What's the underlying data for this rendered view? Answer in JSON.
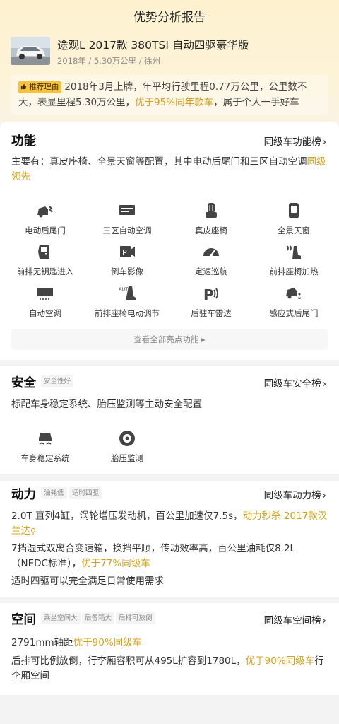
{
  "header": {
    "title": "优势分析报告"
  },
  "car": {
    "name": "途观L 2017款 380TSI 自动四驱豪华版",
    "meta": "2018年 / 5.30万公里 / 徐州"
  },
  "reason": {
    "tag": "推荐理由",
    "text1": "2018年3月上牌，年平均行驶里程0.77万公里，公里数不大，表显里程5.30万公里，",
    "highlight": "优于95%同年款车",
    "text2": "，属于个人一手好车"
  },
  "function": {
    "title": "功能",
    "rank_link": "同级车功能榜",
    "summary1": "主要有：真皮座椅、全景天窗等配置，其中电动后尾门和三区自动空调",
    "summary_hl": "同级领先",
    "features": [
      {
        "label": "电动后尾门",
        "icon": "power-tailgate-icon"
      },
      {
        "label": "三区自动空调",
        "icon": "tri-zone-ac-icon"
      },
      {
        "label": "真皮座椅",
        "icon": "leather-seat-icon"
      },
      {
        "label": "全景天窗",
        "icon": "panoramic-sunroof-icon"
      },
      {
        "label": "前排无钥匙进入",
        "icon": "keyless-entry-icon"
      },
      {
        "label": "倒车影像",
        "icon": "reverse-camera-icon"
      },
      {
        "label": "定速巡航",
        "icon": "cruise-control-icon"
      },
      {
        "label": "前排座椅加热",
        "icon": "seat-heating-icon"
      },
      {
        "label": "自动空调",
        "icon": "auto-ac-icon"
      },
      {
        "label": "前排座椅电动调节",
        "icon": "power-seat-icon"
      },
      {
        "label": "后驻车雷达",
        "icon": "parking-radar-icon"
      },
      {
        "label": "感应式后尾门",
        "icon": "sensor-tailgate-icon"
      }
    ],
    "view_all": "查看全部亮点功能 ▸"
  },
  "safety": {
    "title": "安全",
    "tag": "安全性好",
    "rank_link": "同级车安全榜",
    "summary": "标配车身稳定系统、胎压监测等主动安全配置",
    "features": [
      {
        "label": "车身稳定系统",
        "icon": "stability-control-icon"
      },
      {
        "label": "胎压监测",
        "icon": "tire-pressure-icon"
      }
    ]
  },
  "power": {
    "title": "动力",
    "tags": [
      "油耗低",
      "适时四驱"
    ],
    "rank_link": "同级车动力榜",
    "line1a": "2.0T 直列4缸，涡轮增压发动机，百公里加速仅7.5s，",
    "line1_hl": "动力秒杀 2017款汉兰达",
    "line2a": "7挡湿式双离合变速箱，换挡平顺，传动效率高，百公里油耗仅8.2L（NEDC标准），",
    "line2_hl": "优于77%同级车",
    "line3": "适时四驱可以完全满足日常使用需求"
  },
  "space": {
    "title": "空间",
    "tags": [
      "乘坐空间大",
      "后备箱大",
      "后排可放倒"
    ],
    "rank_link": "同级车空间榜",
    "line1a": "2791mm轴距",
    "line1_hl": "优于90%同级车",
    "line2a": "后排可比例放倒，行李厢容积可从495L扩容到1780L，",
    "line2_hl": "优于90%同级车",
    "line2b": "行李厢空间"
  },
  "colors": {
    "accent": "#d5a11a",
    "tag": "#f9c23c"
  }
}
